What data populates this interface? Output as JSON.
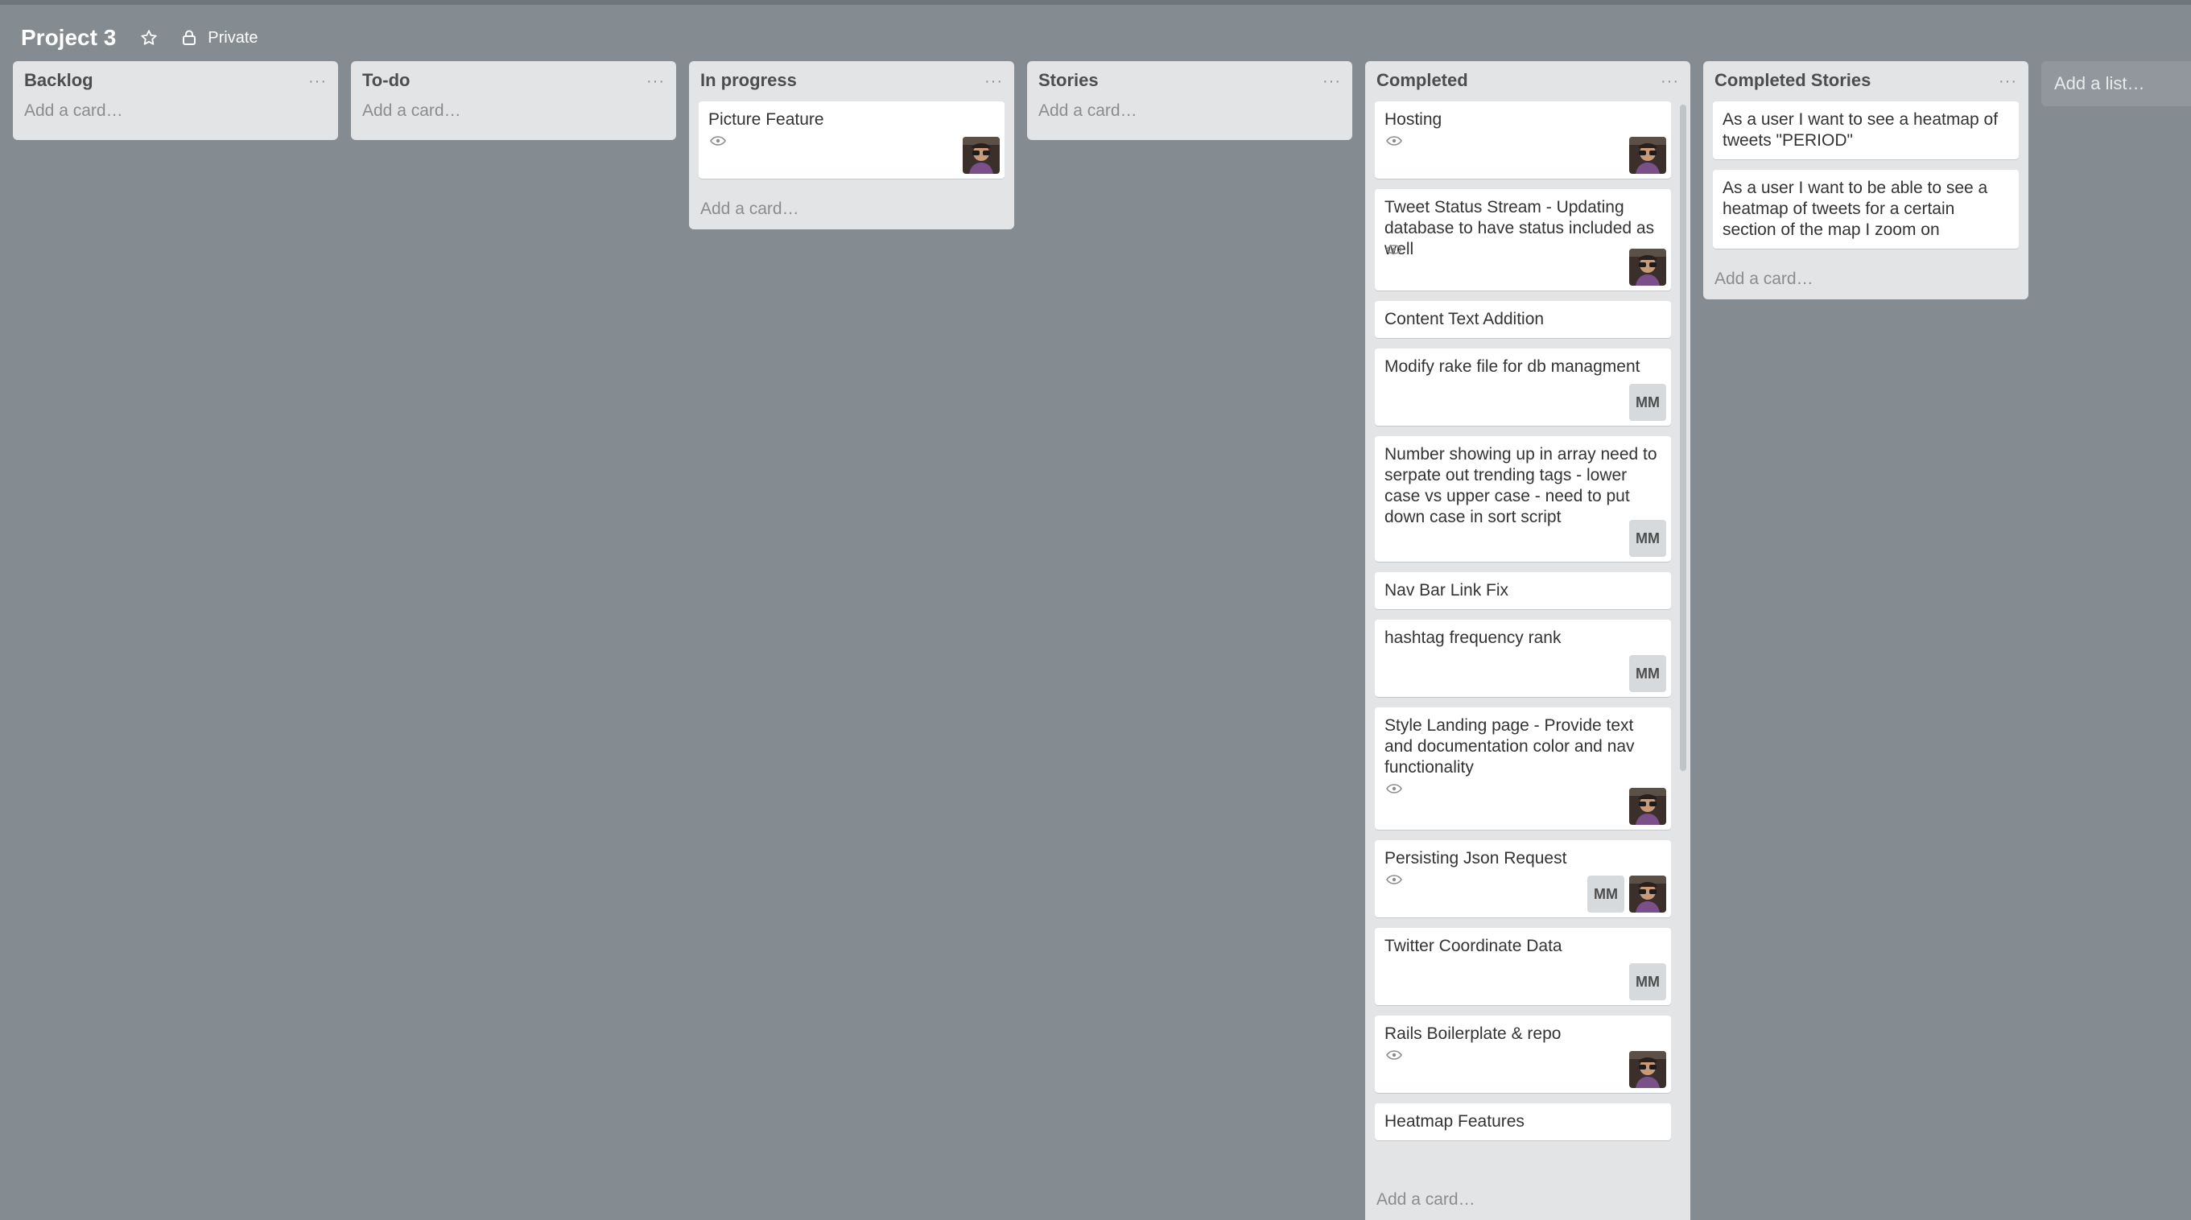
{
  "board": {
    "title": "Project 3",
    "visibility": "Private",
    "star_icon": "star-icon",
    "lock_icon": "lock-icon"
  },
  "colors": {
    "background": "#848b91",
    "list_background": "#e2e4e6",
    "card_background": "#ffffff"
  },
  "add_card_label": "Add a card…",
  "add_list_label": "Add a list…",
  "list_menu_label": "···",
  "lists": [
    {
      "title": "Backlog",
      "cards": []
    },
    {
      "title": "To-do",
      "cards": []
    },
    {
      "title": "In progress",
      "cards": [
        {
          "title": "Picture Feature",
          "watched": true,
          "members": [
            "photo"
          ]
        }
      ]
    },
    {
      "title": "Stories",
      "cards": []
    },
    {
      "title": "Completed",
      "cards": [
        {
          "title": "Hosting",
          "watched": true,
          "members": [
            "photo"
          ]
        },
        {
          "title": "Tweet Status Stream - Updating database to have status included as well",
          "watched": true,
          "members": [
            "photo"
          ]
        },
        {
          "title": "Content Text Addition",
          "watched": false,
          "members": []
        },
        {
          "title": "Modify rake file for db managment",
          "watched": false,
          "members": [
            "MM"
          ]
        },
        {
          "title": "Number showing up in array need to serpate out trending tags - lower case vs upper case - need to put down case in sort script",
          "watched": false,
          "members": [
            "MM"
          ]
        },
        {
          "title": "Nav Bar Link Fix",
          "watched": false,
          "members": []
        },
        {
          "title": "hashtag frequency rank",
          "watched": false,
          "members": [
            "MM"
          ]
        },
        {
          "title": "Style Landing page - Provide text and documentation color and nav functionality",
          "watched": true,
          "members": [
            "photo"
          ]
        },
        {
          "title": "Persisting Json Request",
          "watched": true,
          "members": [
            "MM",
            "photo"
          ]
        },
        {
          "title": "Twitter Coordinate Data",
          "watched": false,
          "members": [
            "MM"
          ]
        },
        {
          "title": "Rails Boilerplate & repo",
          "watched": true,
          "members": [
            "photo"
          ]
        },
        {
          "title": "Heatmap Features",
          "watched": false,
          "members": []
        }
      ]
    },
    {
      "title": "Completed Stories",
      "cards": [
        {
          "title": "As a user I want to see a heatmap of tweets \"PERIOD\"",
          "watched": false,
          "members": []
        },
        {
          "title": "As a user I want to be able to see a heatmap of tweets for a certain section of the map I zoom on",
          "watched": false,
          "members": []
        }
      ]
    }
  ]
}
